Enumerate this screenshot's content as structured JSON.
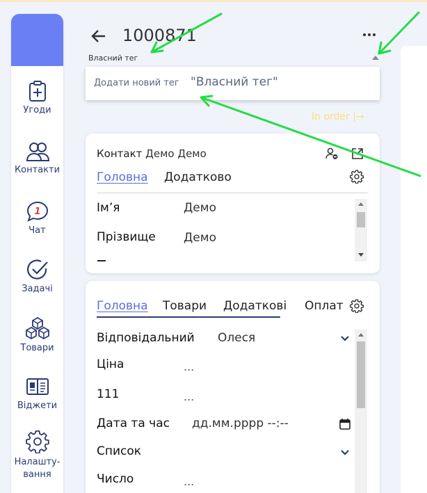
{
  "header": {
    "title": "1000871",
    "tag_label": "Власний тег"
  },
  "tag_dropdown": {
    "add_text": "Додати новий тег",
    "value": "\"Власний тег\""
  },
  "status": {
    "in_order": "In order |→"
  },
  "sidebar": {
    "items": [
      {
        "label": "Угоди",
        "icon": "clipboard-plus-icon"
      },
      {
        "label": "Контакти",
        "icon": "users-icon"
      },
      {
        "label": "Чат",
        "icon": "chat-icon",
        "badge": "1"
      },
      {
        "label": "Задачі",
        "icon": "check-circle-icon"
      },
      {
        "label": "Товари",
        "icon": "cubes-icon"
      },
      {
        "label": "Віджети",
        "icon": "widget-icon"
      },
      {
        "label": "Налашту-",
        "label2": "вання",
        "icon": "gear-icon"
      }
    ]
  },
  "contact_card": {
    "title_prefix": "Контакт",
    "name": "Демо Демо",
    "tabs": [
      "Головна",
      "Додатково"
    ],
    "fields": [
      {
        "label": "Ім’я",
        "value": "Демо"
      },
      {
        "label": "Прізвище",
        "value": "Демо"
      }
    ]
  },
  "deal_card": {
    "tabs": [
      "Головна",
      "Товари",
      "Додаткові",
      "Оплат"
    ],
    "fields": [
      {
        "label": "Відповідальний",
        "value": "Олеся"
      },
      {
        "label": "Ціна",
        "value": "..."
      },
      {
        "label": "111",
        "value": "..."
      },
      {
        "label": "Дата та час",
        "value": "дд.мм.рррр --:--"
      },
      {
        "label": "Список",
        "value": ""
      },
      {
        "label": "Число",
        "value": "..."
      }
    ]
  },
  "colors": {
    "accent": "#5a6ed8",
    "brand": "#6b7ff5",
    "annotation": "#22dd44",
    "badge": "#e23b3b"
  }
}
